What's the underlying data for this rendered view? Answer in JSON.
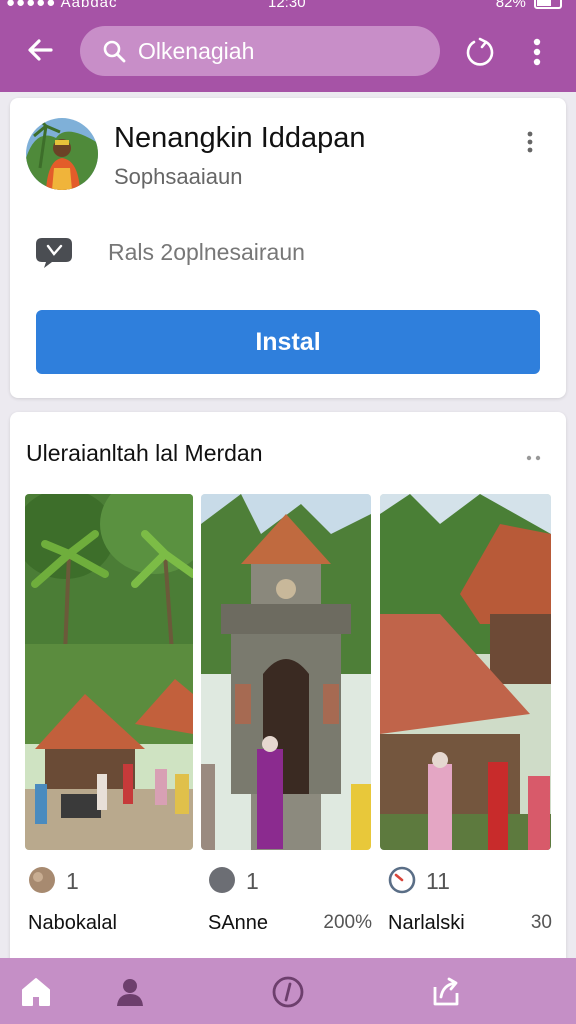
{
  "status_bar": {
    "carrier": "●●●●● Aabdac",
    "time": "12:30",
    "battery": "82%"
  },
  "app_bar": {
    "search_value": "Olkenagiah",
    "icons": [
      "back-arrow-icon",
      "search-icon",
      "refresh-icon",
      "more-vert-icon"
    ]
  },
  "profile": {
    "name": "Nenangkin Iddapan",
    "subtitle": "Sophsaaiaun",
    "info_label": "Rals 2oplnesairaun",
    "install_label": "Instal"
  },
  "gallery": {
    "title": "Uleraianltah lal Merdan",
    "items": [
      {
        "count": "1",
        "name": "Nabokalal",
        "value": ""
      },
      {
        "count": "1",
        "name": "SAnne",
        "value": "200%"
      },
      {
        "count": "11",
        "name": "Narlalski",
        "value": "30"
      }
    ]
  },
  "bottom_nav": {
    "items": [
      "home-icon",
      "profile-icon",
      "compass-icon",
      "share-icon"
    ]
  },
  "colors": {
    "primary": "#a653a6",
    "search_bg": "#c88ec8",
    "install_btn": "#2f7fdc",
    "bottom_nav": "#c58fc6"
  }
}
